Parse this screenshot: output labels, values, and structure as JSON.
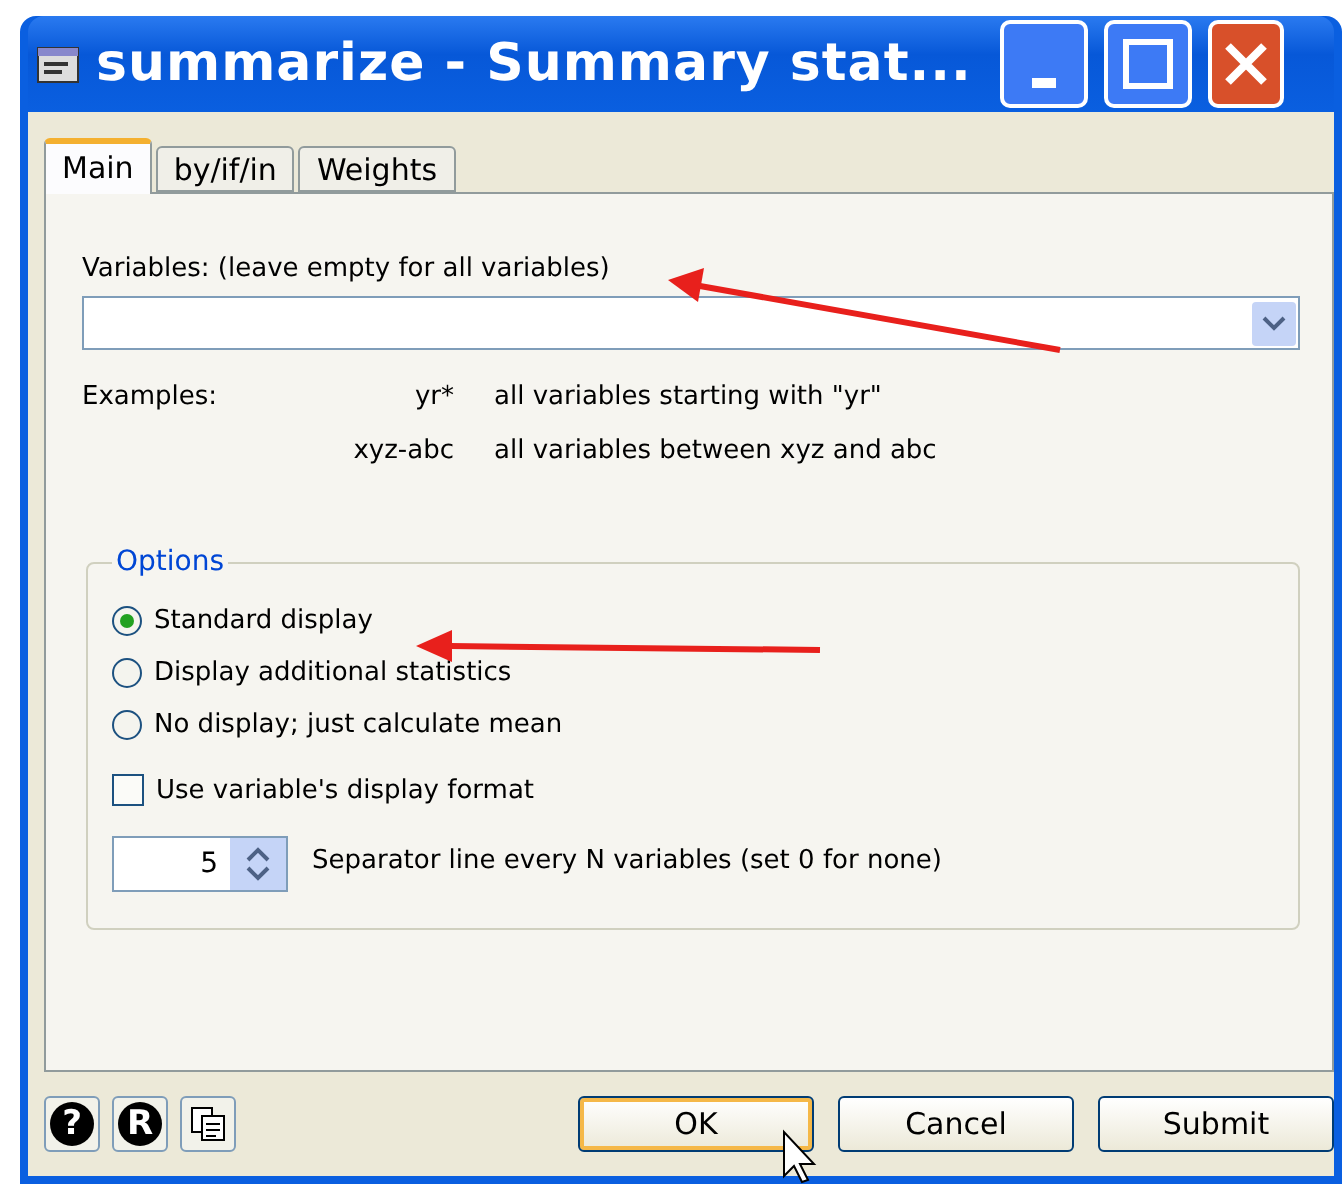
{
  "window": {
    "title": "summarize - Summary stat..."
  },
  "tabs": [
    {
      "label": "Main",
      "selected": true
    },
    {
      "label": "by/if/in",
      "selected": false
    },
    {
      "label": "Weights",
      "selected": false
    }
  ],
  "variables": {
    "label": "Variables: (leave empty for all variables)"
  },
  "examples": {
    "label": "Examples:",
    "rows": [
      {
        "pattern": "yr*",
        "description": "all variables starting with \"yr\""
      },
      {
        "pattern": "xyz-abc",
        "description": "all variables between xyz and abc"
      }
    ]
  },
  "options": {
    "title": "Options",
    "radios": [
      {
        "label": "Standard display",
        "selected": true
      },
      {
        "label": "Display additional statistics",
        "selected": false
      },
      {
        "label": "No display; just calculate mean",
        "selected": false
      }
    ],
    "format_checkbox": {
      "label": "Use variable's display format",
      "checked": false
    },
    "separator": {
      "value": "5",
      "label": "Separator line every N variables (set 0 for none)"
    }
  },
  "footer": {
    "icon_glyphs": [
      "?",
      "R"
    ],
    "buttons": [
      {
        "label": "OK",
        "default": true
      },
      {
        "label": "Cancel",
        "default": false
      },
      {
        "label": "Submit",
        "default": false
      }
    ]
  }
}
